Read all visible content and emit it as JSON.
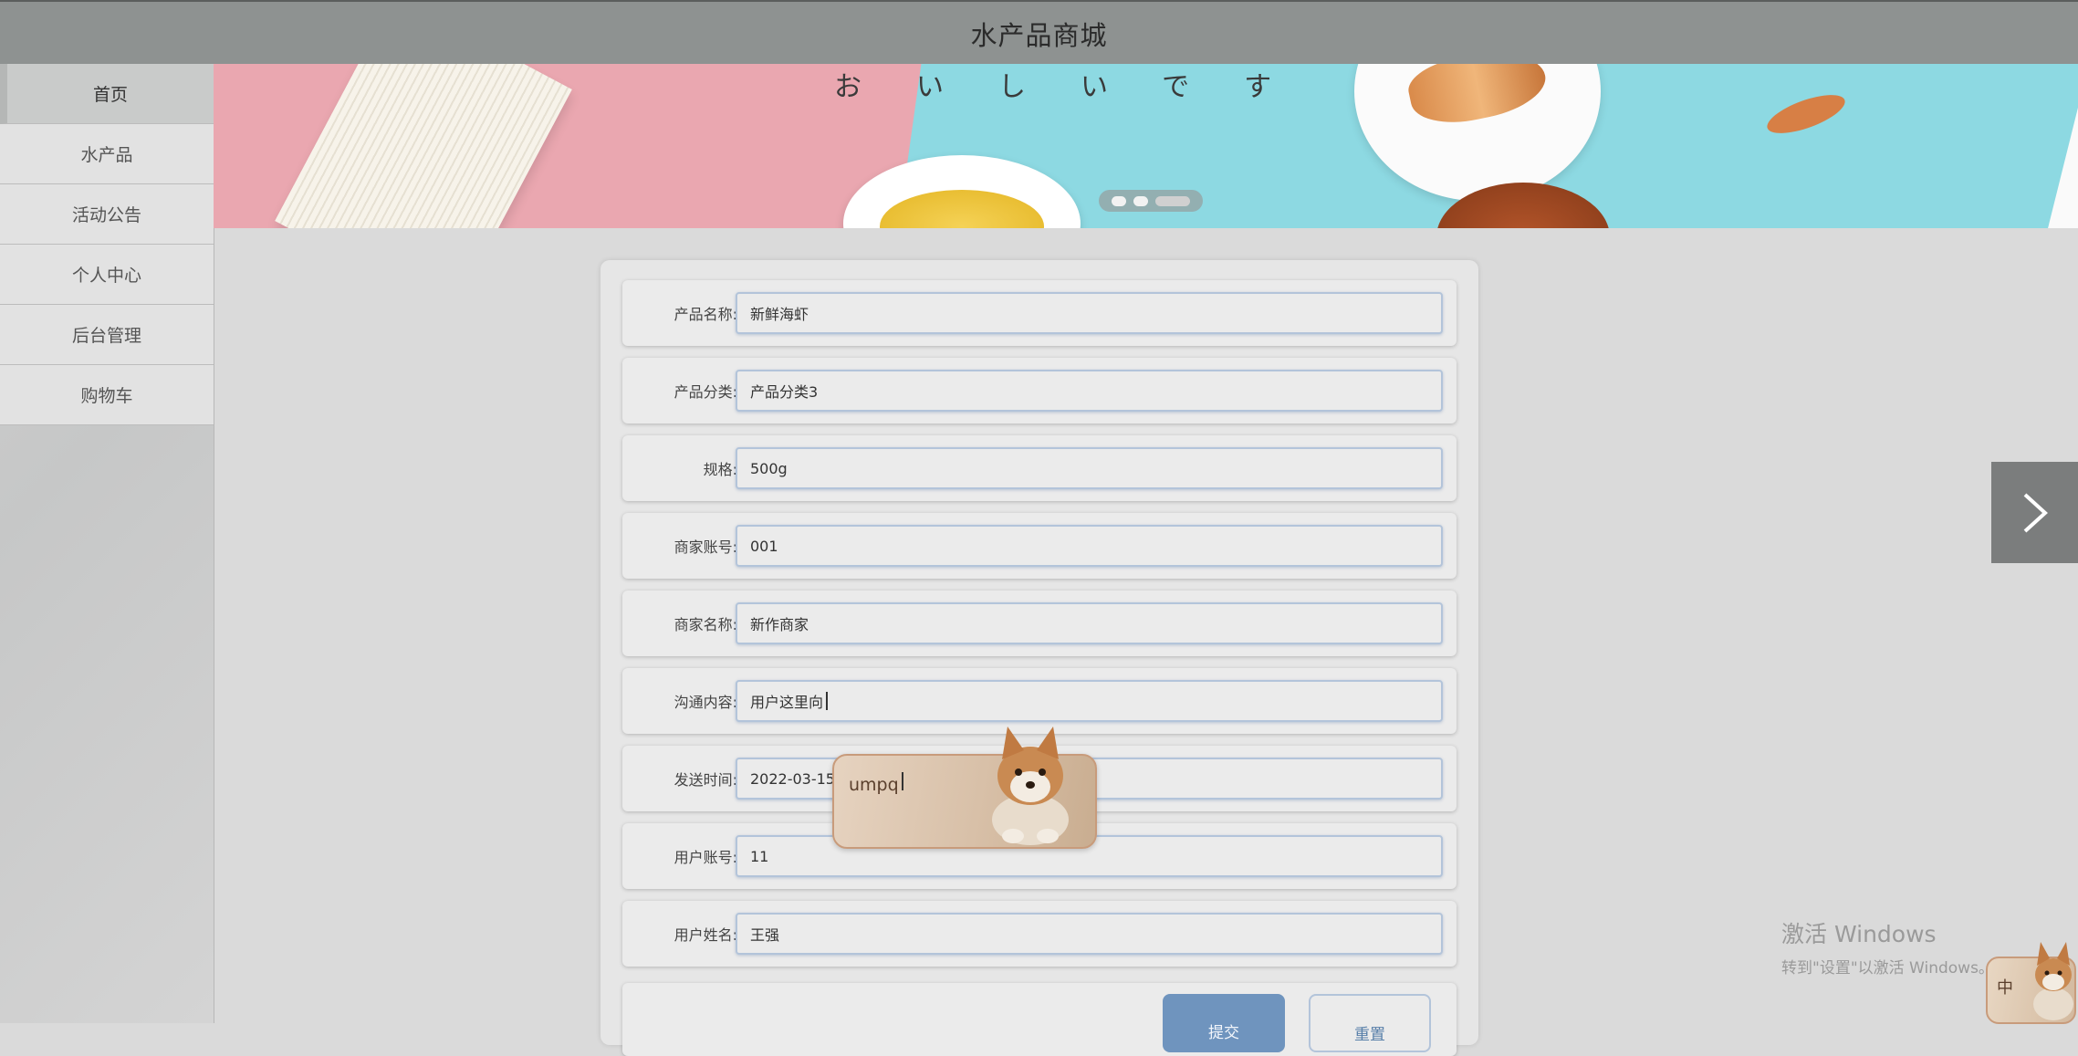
{
  "header": {
    "title": "水产品商城"
  },
  "sidebar": {
    "items": [
      {
        "label": "首页"
      },
      {
        "label": "水产品"
      },
      {
        "label": "活动公告"
      },
      {
        "label": "个人中心"
      },
      {
        "label": "后台管理"
      },
      {
        "label": "购物车"
      }
    ]
  },
  "banner": {
    "tagline": "おいしいです"
  },
  "form": {
    "fields": [
      {
        "label": "产品名称:",
        "value": "新鲜海虾"
      },
      {
        "label": "产品分类:",
        "value": "产品分类3"
      },
      {
        "label": "规格:",
        "value": "500g"
      },
      {
        "label": "商家账号:",
        "value": "001"
      },
      {
        "label": "商家名称:",
        "value": "新作商家"
      },
      {
        "label": "沟通内容:",
        "value": "用户这里向"
      },
      {
        "label": "发送时间:",
        "value": "2022-03-15"
      },
      {
        "label": "用户账号:",
        "value": "11"
      },
      {
        "label": "用户姓名:",
        "value": "王强"
      }
    ],
    "submit_label": "提交",
    "reset_label": "重置"
  },
  "ime": {
    "composing": "umpq",
    "mode": "中"
  },
  "watermark": {
    "line1": "激活 Windows",
    "line2": "转到\"设置\"以激活 Windows。"
  },
  "colors": {
    "header_bg": "#8e9291",
    "submit_bg": "#6f94be",
    "input_border": "#b3c4da"
  },
  "icons": {
    "next": "chevron-right-icon"
  }
}
